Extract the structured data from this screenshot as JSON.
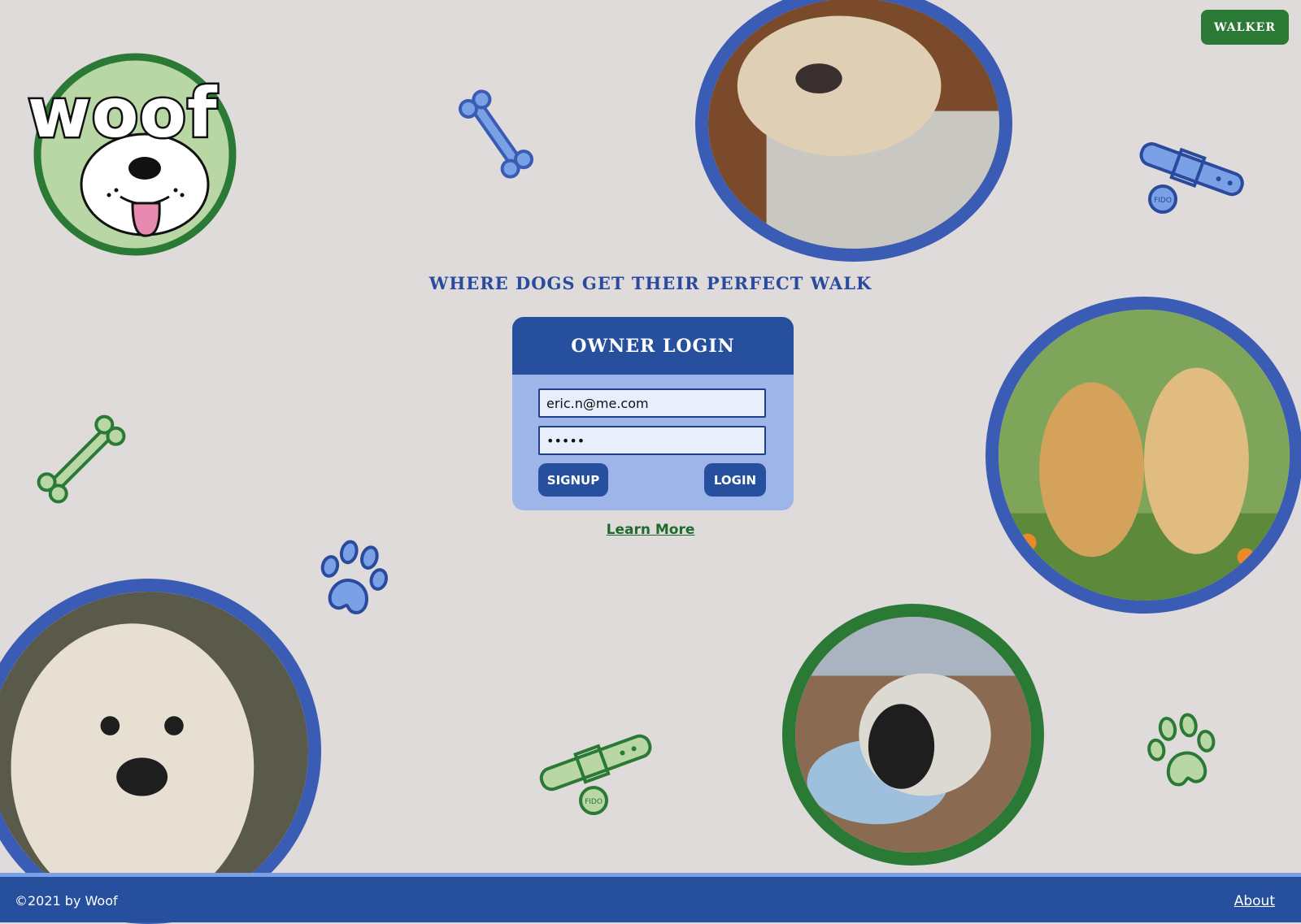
{
  "header": {
    "brand": "woof",
    "walker_label": "WALKER"
  },
  "tagline": "WHERE DOGS GET THEIR PERFECT WALK",
  "login": {
    "title": "OWNER LOGIN",
    "email_value": "eric.n@me.com",
    "password_value": "•••••",
    "signup_label": "SIGNUP",
    "login_label": "LOGIN"
  },
  "learn_more": "Learn More",
  "footer": {
    "copyright": "©2021 by Woof",
    "about": "About"
  },
  "decor": {
    "collar_tag": "FIDO"
  },
  "colors": {
    "primary_blue": "#264f9e",
    "accent_green": "#2a7a35",
    "background": "#e0dbdb"
  }
}
